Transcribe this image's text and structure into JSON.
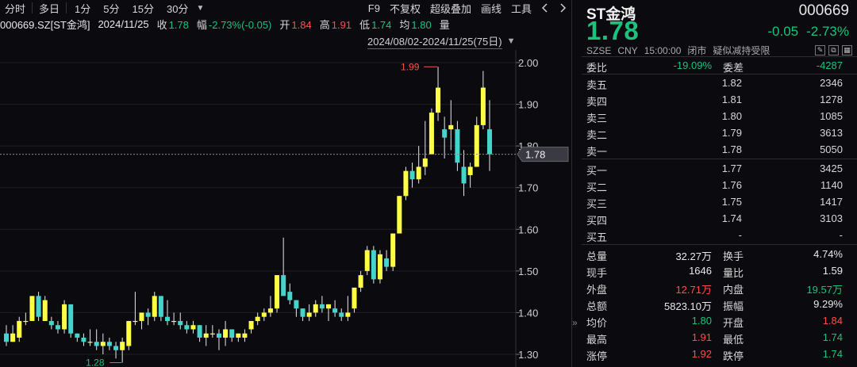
{
  "toolbar": {
    "timeshare": "分时",
    "multiday": "多日",
    "periods": [
      "1分",
      "5分",
      "15分",
      "30分"
    ],
    "f9": "F9",
    "adjust": "不复权",
    "overlay": "超级叠加",
    "draw": "画线",
    "tools": "工具"
  },
  "infobar": {
    "symbol": "000669.SZ[ST金鸿]",
    "date": "2024/11/25",
    "close_label": "收",
    "close": "1.78",
    "change_label": "幅",
    "change": "-2.73%(-0.05)",
    "open_label": "开",
    "open": "1.84",
    "high_label": "高",
    "high": "1.91",
    "low_label": "低",
    "low": "1.74",
    "avg_label": "均",
    "avg": "1.80",
    "vol_label": "量"
  },
  "range": {
    "text": "2024/08/02-2024/11/25(75日)"
  },
  "colors": {
    "up": "#ff4d4f",
    "down": "#19c37d",
    "bull": "#ffff46",
    "bear": "#43d5cb",
    "bg": "#0b0b0f"
  },
  "chart_data": {
    "type": "candlestick",
    "ylim": [
      1.28,
      2.04
    ],
    "yticks": [
      "2.00",
      "1.90",
      "1.80",
      "1.70",
      "1.60",
      "1.50",
      "1.40",
      "1.30"
    ],
    "current_price": "1.78",
    "max_label": "1.99",
    "min_label": "1.28",
    "candles": [
      {
        "o": 1.35,
        "h": 1.37,
        "l": 1.32,
        "c": 1.33
      },
      {
        "o": 1.33,
        "h": 1.37,
        "l": 1.33,
        "c": 1.35
      },
      {
        "o": 1.34,
        "h": 1.39,
        "l": 1.33,
        "c": 1.38
      },
      {
        "o": 1.38,
        "h": 1.4,
        "l": 1.37,
        "c": 1.38
      },
      {
        "o": 1.38,
        "h": 1.44,
        "l": 1.38,
        "c": 1.44
      },
      {
        "o": 1.44,
        "h": 1.45,
        "l": 1.38,
        "c": 1.39
      },
      {
        "o": 1.38,
        "h": 1.44,
        "l": 1.38,
        "c": 1.43
      },
      {
        "o": 1.38,
        "h": 1.39,
        "l": 1.36,
        "c": 1.37
      },
      {
        "o": 1.37,
        "h": 1.38,
        "l": 1.35,
        "c": 1.36
      },
      {
        "o": 1.36,
        "h": 1.43,
        "l": 1.35,
        "c": 1.42
      },
      {
        "o": 1.42,
        "h": 1.42,
        "l": 1.34,
        "c": 1.35
      },
      {
        "o": 1.35,
        "h": 1.35,
        "l": 1.33,
        "c": 1.34
      },
      {
        "o": 1.34,
        "h": 1.35,
        "l": 1.32,
        "c": 1.33
      },
      {
        "o": 1.33,
        "h": 1.36,
        "l": 1.32,
        "c": 1.33
      },
      {
        "o": 1.33,
        "h": 1.36,
        "l": 1.31,
        "c": 1.32
      },
      {
        "o": 1.32,
        "h": 1.35,
        "l": 1.3,
        "c": 1.33
      },
      {
        "o": 1.33,
        "h": 1.34,
        "l": 1.31,
        "c": 1.32
      },
      {
        "o": 1.32,
        "h": 1.33,
        "l": 1.29,
        "c": 1.31
      },
      {
        "o": 1.31,
        "h": 1.34,
        "l": 1.28,
        "c": 1.33
      },
      {
        "o": 1.32,
        "h": 1.38,
        "l": 1.31,
        "c": 1.38
      },
      {
        "o": 1.38,
        "h": 1.45,
        "l": 1.37,
        "c": 1.38
      },
      {
        "o": 1.38,
        "h": 1.4,
        "l": 1.36,
        "c": 1.4
      },
      {
        "o": 1.4,
        "h": 1.41,
        "l": 1.37,
        "c": 1.39
      },
      {
        "o": 1.39,
        "h": 1.45,
        "l": 1.38,
        "c": 1.44
      },
      {
        "o": 1.44,
        "h": 1.44,
        "l": 1.38,
        "c": 1.39
      },
      {
        "o": 1.39,
        "h": 1.43,
        "l": 1.37,
        "c": 1.38
      },
      {
        "o": 1.38,
        "h": 1.4,
        "l": 1.37,
        "c": 1.38
      },
      {
        "o": 1.38,
        "h": 1.4,
        "l": 1.36,
        "c": 1.37
      },
      {
        "o": 1.37,
        "h": 1.38,
        "l": 1.35,
        "c": 1.36
      },
      {
        "o": 1.36,
        "h": 1.38,
        "l": 1.35,
        "c": 1.37
      },
      {
        "o": 1.37,
        "h": 1.37,
        "l": 1.33,
        "c": 1.34
      },
      {
        "o": 1.34,
        "h": 1.37,
        "l": 1.32,
        "c": 1.35
      },
      {
        "o": 1.35,
        "h": 1.37,
        "l": 1.34,
        "c": 1.35
      },
      {
        "o": 1.35,
        "h": 1.36,
        "l": 1.31,
        "c": 1.34
      },
      {
        "o": 1.34,
        "h": 1.38,
        "l": 1.32,
        "c": 1.36
      },
      {
        "o": 1.36,
        "h": 1.36,
        "l": 1.33,
        "c": 1.34
      },
      {
        "o": 1.34,
        "h": 1.35,
        "l": 1.33,
        "c": 1.35
      },
      {
        "o": 1.34,
        "h": 1.36,
        "l": 1.33,
        "c": 1.35
      },
      {
        "o": 1.36,
        "h": 1.38,
        "l": 1.35,
        "c": 1.38
      },
      {
        "o": 1.38,
        "h": 1.4,
        "l": 1.37,
        "c": 1.39
      },
      {
        "o": 1.39,
        "h": 1.41,
        "l": 1.38,
        "c": 1.4
      },
      {
        "o": 1.4,
        "h": 1.44,
        "l": 1.39,
        "c": 1.41
      },
      {
        "o": 1.41,
        "h": 1.49,
        "l": 1.4,
        "c": 1.49
      },
      {
        "o": 1.49,
        "h": 1.58,
        "l": 1.45,
        "c": 1.44
      },
      {
        "o": 1.45,
        "h": 1.47,
        "l": 1.42,
        "c": 1.43
      },
      {
        "o": 1.43,
        "h": 1.43,
        "l": 1.39,
        "c": 1.41
      },
      {
        "o": 1.41,
        "h": 1.41,
        "l": 1.38,
        "c": 1.39
      },
      {
        "o": 1.39,
        "h": 1.42,
        "l": 1.38,
        "c": 1.4
      },
      {
        "o": 1.4,
        "h": 1.43,
        "l": 1.39,
        "c": 1.42
      },
      {
        "o": 1.42,
        "h": 1.44,
        "l": 1.4,
        "c": 1.41
      },
      {
        "o": 1.41,
        "h": 1.42,
        "l": 1.38,
        "c": 1.42
      },
      {
        "o": 1.41,
        "h": 1.43,
        "l": 1.39,
        "c": 1.4
      },
      {
        "o": 1.4,
        "h": 1.41,
        "l": 1.38,
        "c": 1.39
      },
      {
        "o": 1.39,
        "h": 1.44,
        "l": 1.38,
        "c": 1.4
      },
      {
        "o": 1.41,
        "h": 1.46,
        "l": 1.4,
        "c": 1.46
      },
      {
        "o": 1.46,
        "h": 1.5,
        "l": 1.45,
        "c": 1.49
      },
      {
        "o": 1.5,
        "h": 1.56,
        "l": 1.49,
        "c": 1.55
      },
      {
        "o": 1.55,
        "h": 1.56,
        "l": 1.47,
        "c": 1.48
      },
      {
        "o": 1.48,
        "h": 1.55,
        "l": 1.47,
        "c": 1.54
      },
      {
        "o": 1.53,
        "h": 1.55,
        "l": 1.5,
        "c": 1.51
      },
      {
        "o": 1.51,
        "h": 1.59,
        "l": 1.5,
        "c": 1.59
      },
      {
        "o": 1.59,
        "h": 1.68,
        "l": 1.59,
        "c": 1.68
      },
      {
        "o": 1.68,
        "h": 1.75,
        "l": 1.67,
        "c": 1.74
      },
      {
        "o": 1.74,
        "h": 1.76,
        "l": 1.7,
        "c": 1.72
      },
      {
        "o": 1.72,
        "h": 1.8,
        "l": 1.71,
        "c": 1.75
      },
      {
        "o": 1.75,
        "h": 1.86,
        "l": 1.73,
        "c": 1.77
      },
      {
        "o": 1.78,
        "h": 1.89,
        "l": 1.78,
        "c": 1.88
      },
      {
        "o": 1.88,
        "h": 1.99,
        "l": 1.86,
        "c": 1.94
      },
      {
        "o": 1.84,
        "h": 1.87,
        "l": 1.77,
        "c": 1.82
      },
      {
        "o": 1.84,
        "h": 1.91,
        "l": 1.79,
        "c": 1.85
      },
      {
        "o": 1.84,
        "h": 1.86,
        "l": 1.74,
        "c": 1.76
      },
      {
        "o": 1.75,
        "h": 1.79,
        "l": 1.68,
        "c": 1.71
      },
      {
        "o": 1.73,
        "h": 1.76,
        "l": 1.7,
        "c": 1.75
      },
      {
        "o": 1.75,
        "h": 1.87,
        "l": 1.75,
        "c": 1.85
      },
      {
        "o": 1.85,
        "h": 1.98,
        "l": 1.84,
        "c": 1.94
      },
      {
        "o": 1.84,
        "h": 1.91,
        "l": 1.74,
        "c": 1.78
      }
    ]
  },
  "quote": {
    "name": "ST金鸿",
    "code": "000669",
    "price": "1.78",
    "change": "-0.05",
    "change_pct": "-2.73%",
    "exchange": "SZSE",
    "currency": "CNY",
    "time": "15:00:00",
    "status": "闭市",
    "note": "疑似减持受限"
  },
  "commission": {
    "ratio_label": "委比",
    "ratio": "-19.09%",
    "diff_label": "委差",
    "diff": "-4287"
  },
  "asks": [
    {
      "label": "卖五",
      "price": "1.82",
      "vol": "2346"
    },
    {
      "label": "卖四",
      "price": "1.81",
      "vol": "1278"
    },
    {
      "label": "卖三",
      "price": "1.80",
      "vol": "1085"
    },
    {
      "label": "卖二",
      "price": "1.79",
      "vol": "3613"
    },
    {
      "label": "卖一",
      "price": "1.78",
      "vol": "5050"
    }
  ],
  "bids": [
    {
      "label": "买一",
      "price": "1.77",
      "vol": "3425"
    },
    {
      "label": "买二",
      "price": "1.76",
      "vol": "1140"
    },
    {
      "label": "买三",
      "price": "1.75",
      "vol": "1417"
    },
    {
      "label": "买四",
      "price": "1.74",
      "vol": "3103"
    },
    {
      "label": "买五",
      "price": "-",
      "vol": "-"
    }
  ],
  "stats": [
    {
      "l1": "总量",
      "v1": "32.27万",
      "c1": "white",
      "l2": "换手",
      "v2": "4.74%",
      "c2": "white"
    },
    {
      "l1": "现手",
      "v1": "1646",
      "c1": "white",
      "l2": "量比",
      "v2": "1.59",
      "c2": "white"
    },
    {
      "l1": "外盘",
      "v1": "12.71万",
      "c1": "red",
      "l2": "内盘",
      "v2": "19.57万",
      "c2": "green"
    },
    {
      "l1": "总额",
      "v1": "5823.10万",
      "c1": "white",
      "l2": "振幅",
      "v2": "9.29%",
      "c2": "white"
    },
    {
      "l1": "均价",
      "v1": "1.80",
      "c1": "green",
      "l2": "开盘",
      "v2": "1.84",
      "c2": "red"
    },
    {
      "l1": "最高",
      "v1": "1.91",
      "c1": "red",
      "l2": "最低",
      "v2": "1.74",
      "c2": "green"
    },
    {
      "l1": "涨停",
      "v1": "1.92",
      "c1": "red",
      "l2": "跌停",
      "v2": "1.74",
      "c2": "green"
    }
  ]
}
